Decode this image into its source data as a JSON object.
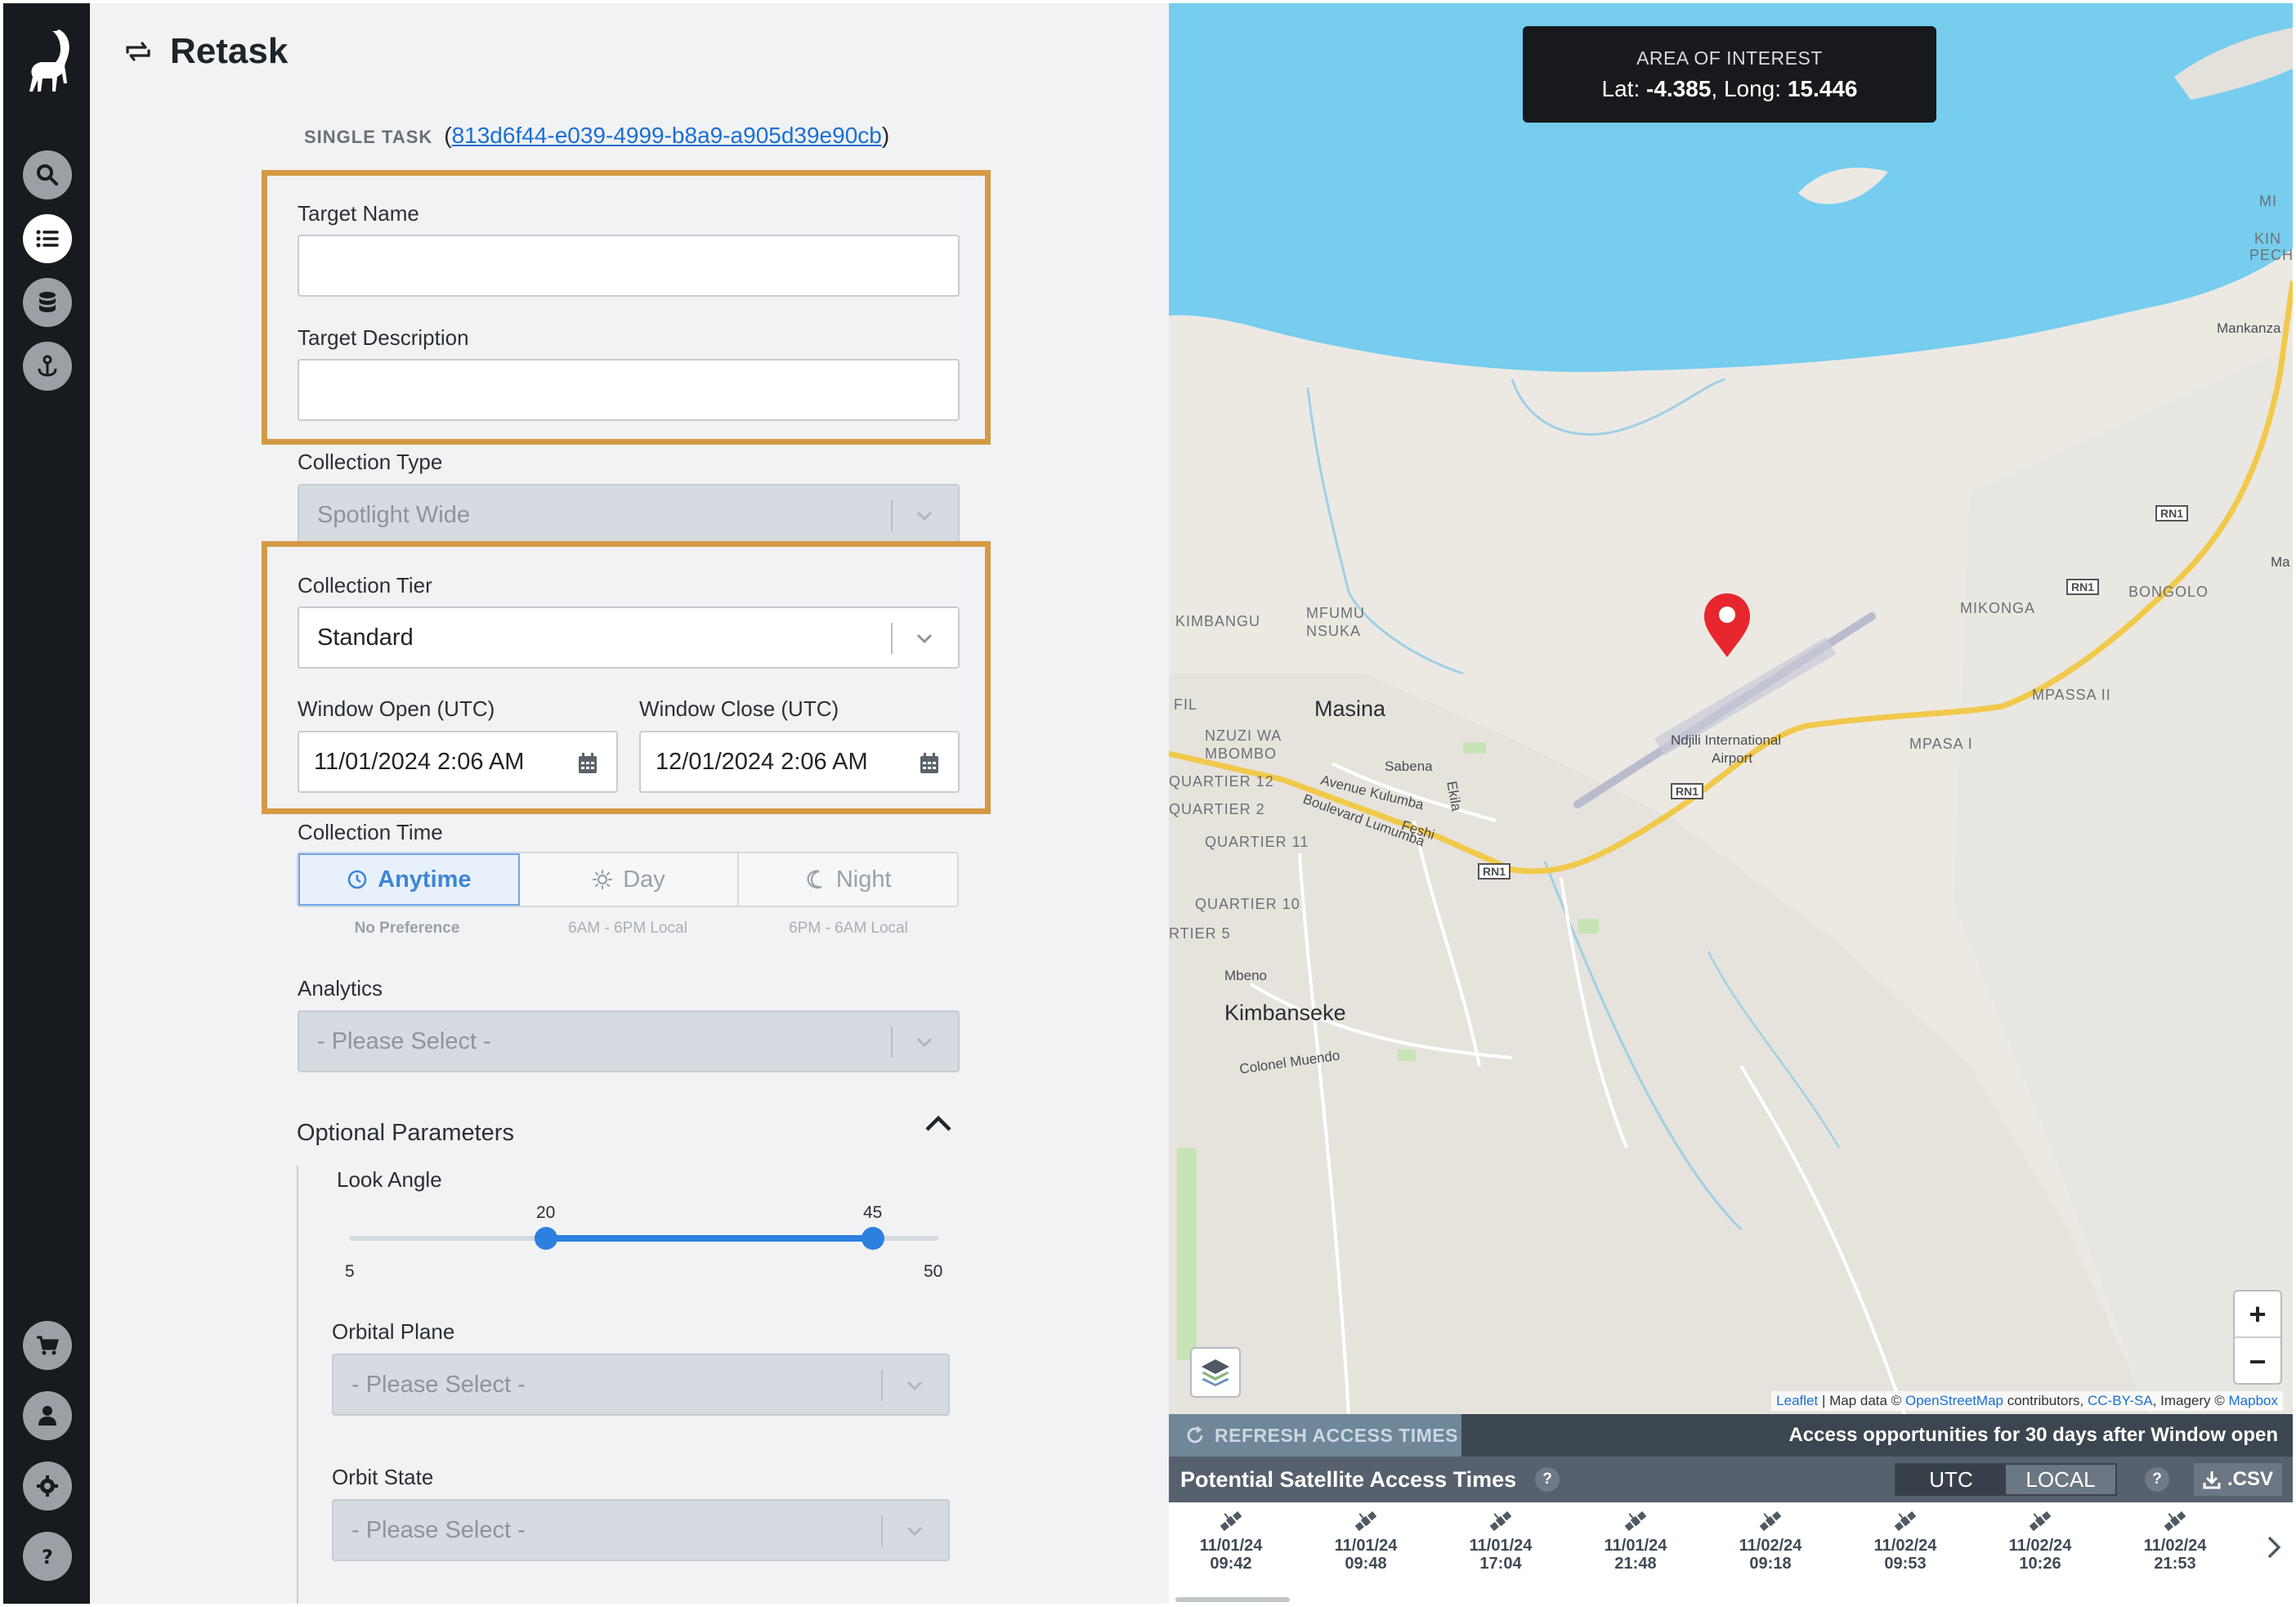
{
  "page": {
    "title": "Retask"
  },
  "nav": {
    "items": [
      {
        "name": "search",
        "icon": "search-icon"
      },
      {
        "name": "tasks",
        "icon": "task-list-icon",
        "active": true
      },
      {
        "name": "database",
        "icon": "database-icon"
      },
      {
        "name": "anchor",
        "icon": "anchor-icon"
      },
      {
        "name": "cart",
        "icon": "cart-icon"
      },
      {
        "name": "account",
        "icon": "user-icon"
      },
      {
        "name": "settings",
        "icon": "gear-icon"
      },
      {
        "name": "help",
        "icon": "help-icon"
      }
    ]
  },
  "task": {
    "kind": "SINGLE TASK",
    "id": "813d6f44-e039-4999-b8a9-a905d39e90cb"
  },
  "form": {
    "target_name_label": "Target Name",
    "target_name_value": "",
    "target_description_label": "Target Description",
    "target_description_value": "",
    "collection_type_label": "Collection Type",
    "collection_type_value": "Spotlight Wide",
    "collection_tier_label": "Collection Tier",
    "collection_tier_value": "Standard",
    "window_open_label": "Window Open (UTC)",
    "window_open_value": "11/01/2024 2:06 AM",
    "window_close_label": "Window Close (UTC)",
    "window_close_value": "12/01/2024 2:06 AM",
    "collection_time_label": "Collection Time",
    "collection_time_options": [
      {
        "label": "Anytime",
        "sub": "No Preference",
        "icon": "clock-icon",
        "selected": true
      },
      {
        "label": "Day",
        "sub": "6AM - 6PM Local",
        "icon": "sun-icon",
        "selected": false
      },
      {
        "label": "Night",
        "sub": "6PM - 6AM Local",
        "icon": "moon-icon",
        "selected": false
      }
    ],
    "analytics_label": "Analytics",
    "analytics_value": "- Please Select -",
    "optional_label": "Optional Parameters",
    "look_angle_label": "Look Angle",
    "look_angle": {
      "min": 5,
      "max": 50,
      "low": 20,
      "high": 45,
      "min_text": "5",
      "max_text": "50",
      "low_text": "20",
      "high_text": "45"
    },
    "orbital_plane_label": "Orbital Plane",
    "orbital_plane_value": "- Please Select -",
    "orbit_state_label": "Orbit State",
    "orbit_state_value": "- Please Select -"
  },
  "highlight_color": "#d49a45",
  "accent_color": "#2d7fe0",
  "map": {
    "aoi_title": "AREA OF INTEREST",
    "lat_label": "Lat:",
    "lat_value": "-4.385",
    "long_label": "Long:",
    "long_value": "15.446",
    "labels": {
      "masina": "Masina",
      "kimbanseke": "Kimbanseke",
      "mankanza": "Mankanza",
      "kimbangu": "KIMBANGU",
      "mfumu": "MFUMU",
      "nsuka": "NSUKA",
      "nzuzi": "NZUZI WA",
      "mbombo": "MBOMBO",
      "q12": "QUARTIER 12",
      "q2": "QUARTIER 2",
      "q11": "QUARTIER 11",
      "q10": "QUARTIER 10",
      "q5": "RTIER 5",
      "mikonga": "MIKONGA",
      "bongolo": "BONGOLO",
      "mpassa2": "MPASSA II",
      "mpasa1": "MPASA I",
      "airport1": "Ndjili International",
      "airport2": "Airport",
      "sabena": "Sabena",
      "mbeno": "Mbeno",
      "colonel": "Colonel Muendo",
      "kulumba": "Avenue Kulumba",
      "lumumba": "Boulevard Lumumba",
      "feshi": "Feshi",
      "ekila": "Ekila",
      "rn1": "RN1",
      "fil": "FIL",
      "mi": "MI",
      "kin": "KIN",
      "pech": "PECH",
      "ma": "Ma"
    },
    "zoom_in": "+",
    "zoom_out": "−",
    "attribution": {
      "leaflet": "Leaflet",
      "data": "| Map data ©",
      "osm": "OpenStreetMap",
      "contrib": "contributors,",
      "cc": "CC-BY-SA",
      "imagery": ", Imagery ©",
      "mapbox": "Mapbox"
    },
    "water_color": "#76cdee",
    "land_color": "#ece9e3"
  },
  "access": {
    "refresh_label": "REFRESH ACCESS TIMES",
    "note": "Access opportunities for 30 days after Window open",
    "title": "Potential Satellite Access Times",
    "utc": "UTC",
    "local": "LOCAL",
    "csv": ".CSV",
    "help": "?",
    "times": [
      {
        "date": "11/01/24",
        "time": "09:42"
      },
      {
        "date": "11/01/24",
        "time": "09:48"
      },
      {
        "date": "11/01/24",
        "time": "17:04"
      },
      {
        "date": "11/01/24",
        "time": "21:48"
      },
      {
        "date": "11/02/24",
        "time": "09:18"
      },
      {
        "date": "11/02/24",
        "time": "09:53"
      },
      {
        "date": "11/02/24",
        "time": "10:26"
      },
      {
        "date": "11/02/24",
        "time": "21:53"
      }
    ]
  }
}
